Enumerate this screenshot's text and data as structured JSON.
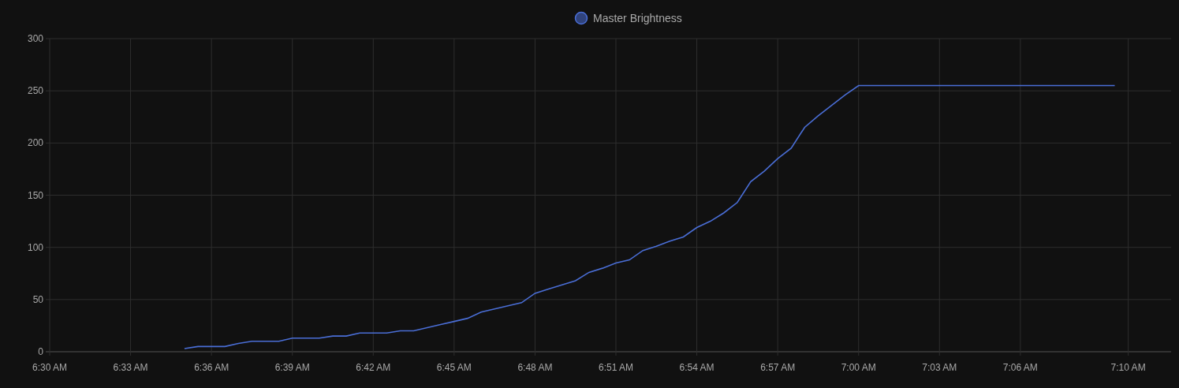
{
  "chart": {
    "chart_data": {
      "type": "line",
      "categories": [
        "6:30 AM",
        null,
        null,
        null,
        null,
        null,
        "6:33 AM",
        null,
        null,
        null,
        null,
        null,
        "6:36 AM",
        null,
        null,
        null,
        null,
        null,
        "6:39 AM",
        null,
        null,
        null,
        null,
        null,
        "6:42 AM",
        null,
        null,
        null,
        null,
        null,
        "6:45 AM",
        null,
        null,
        null,
        null,
        null,
        "6:48 AM",
        null,
        null,
        null,
        null,
        null,
        "6:51 AM",
        null,
        null,
        null,
        null,
        null,
        "6:54 AM",
        null,
        null,
        null,
        null,
        null,
        "6:57 AM",
        null,
        null,
        null,
        null,
        null,
        "7:00 AM",
        null,
        null,
        null,
        null,
        null,
        "7:03 AM",
        null,
        null,
        null,
        null,
        null,
        "7:06 AM",
        null,
        null,
        null,
        null,
        null,
        null,
        null,
        "7:10 AM",
        null,
        null,
        null
      ],
      "series": [
        {
          "name": "Master Brightness",
          "color": "#4a6ed6",
          "values": [
            null,
            null,
            null,
            null,
            null,
            null,
            null,
            null,
            null,
            null,
            3,
            5,
            5,
            5,
            8,
            10,
            10,
            10,
            13,
            13,
            13,
            15,
            15,
            18,
            18,
            18,
            20,
            20,
            23,
            26,
            29,
            32,
            38,
            41,
            44,
            47,
            56,
            60,
            64,
            68,
            76,
            80,
            85,
            88,
            97,
            101,
            106,
            110,
            119,
            125,
            133,
            143,
            163,
            173,
            185,
            195,
            215,
            226,
            236,
            246,
            255,
            255,
            255,
            255,
            255,
            255,
            255,
            255,
            255,
            255,
            255,
            255,
            255,
            255,
            255,
            255,
            255,
            255,
            255,
            255,
            null,
            null,
            null,
            null
          ]
        }
      ],
      "grid": true,
      "ylim": [
        0,
        300
      ],
      "yticks": [
        0,
        50,
        100,
        150,
        200,
        250,
        300
      ]
    }
  }
}
